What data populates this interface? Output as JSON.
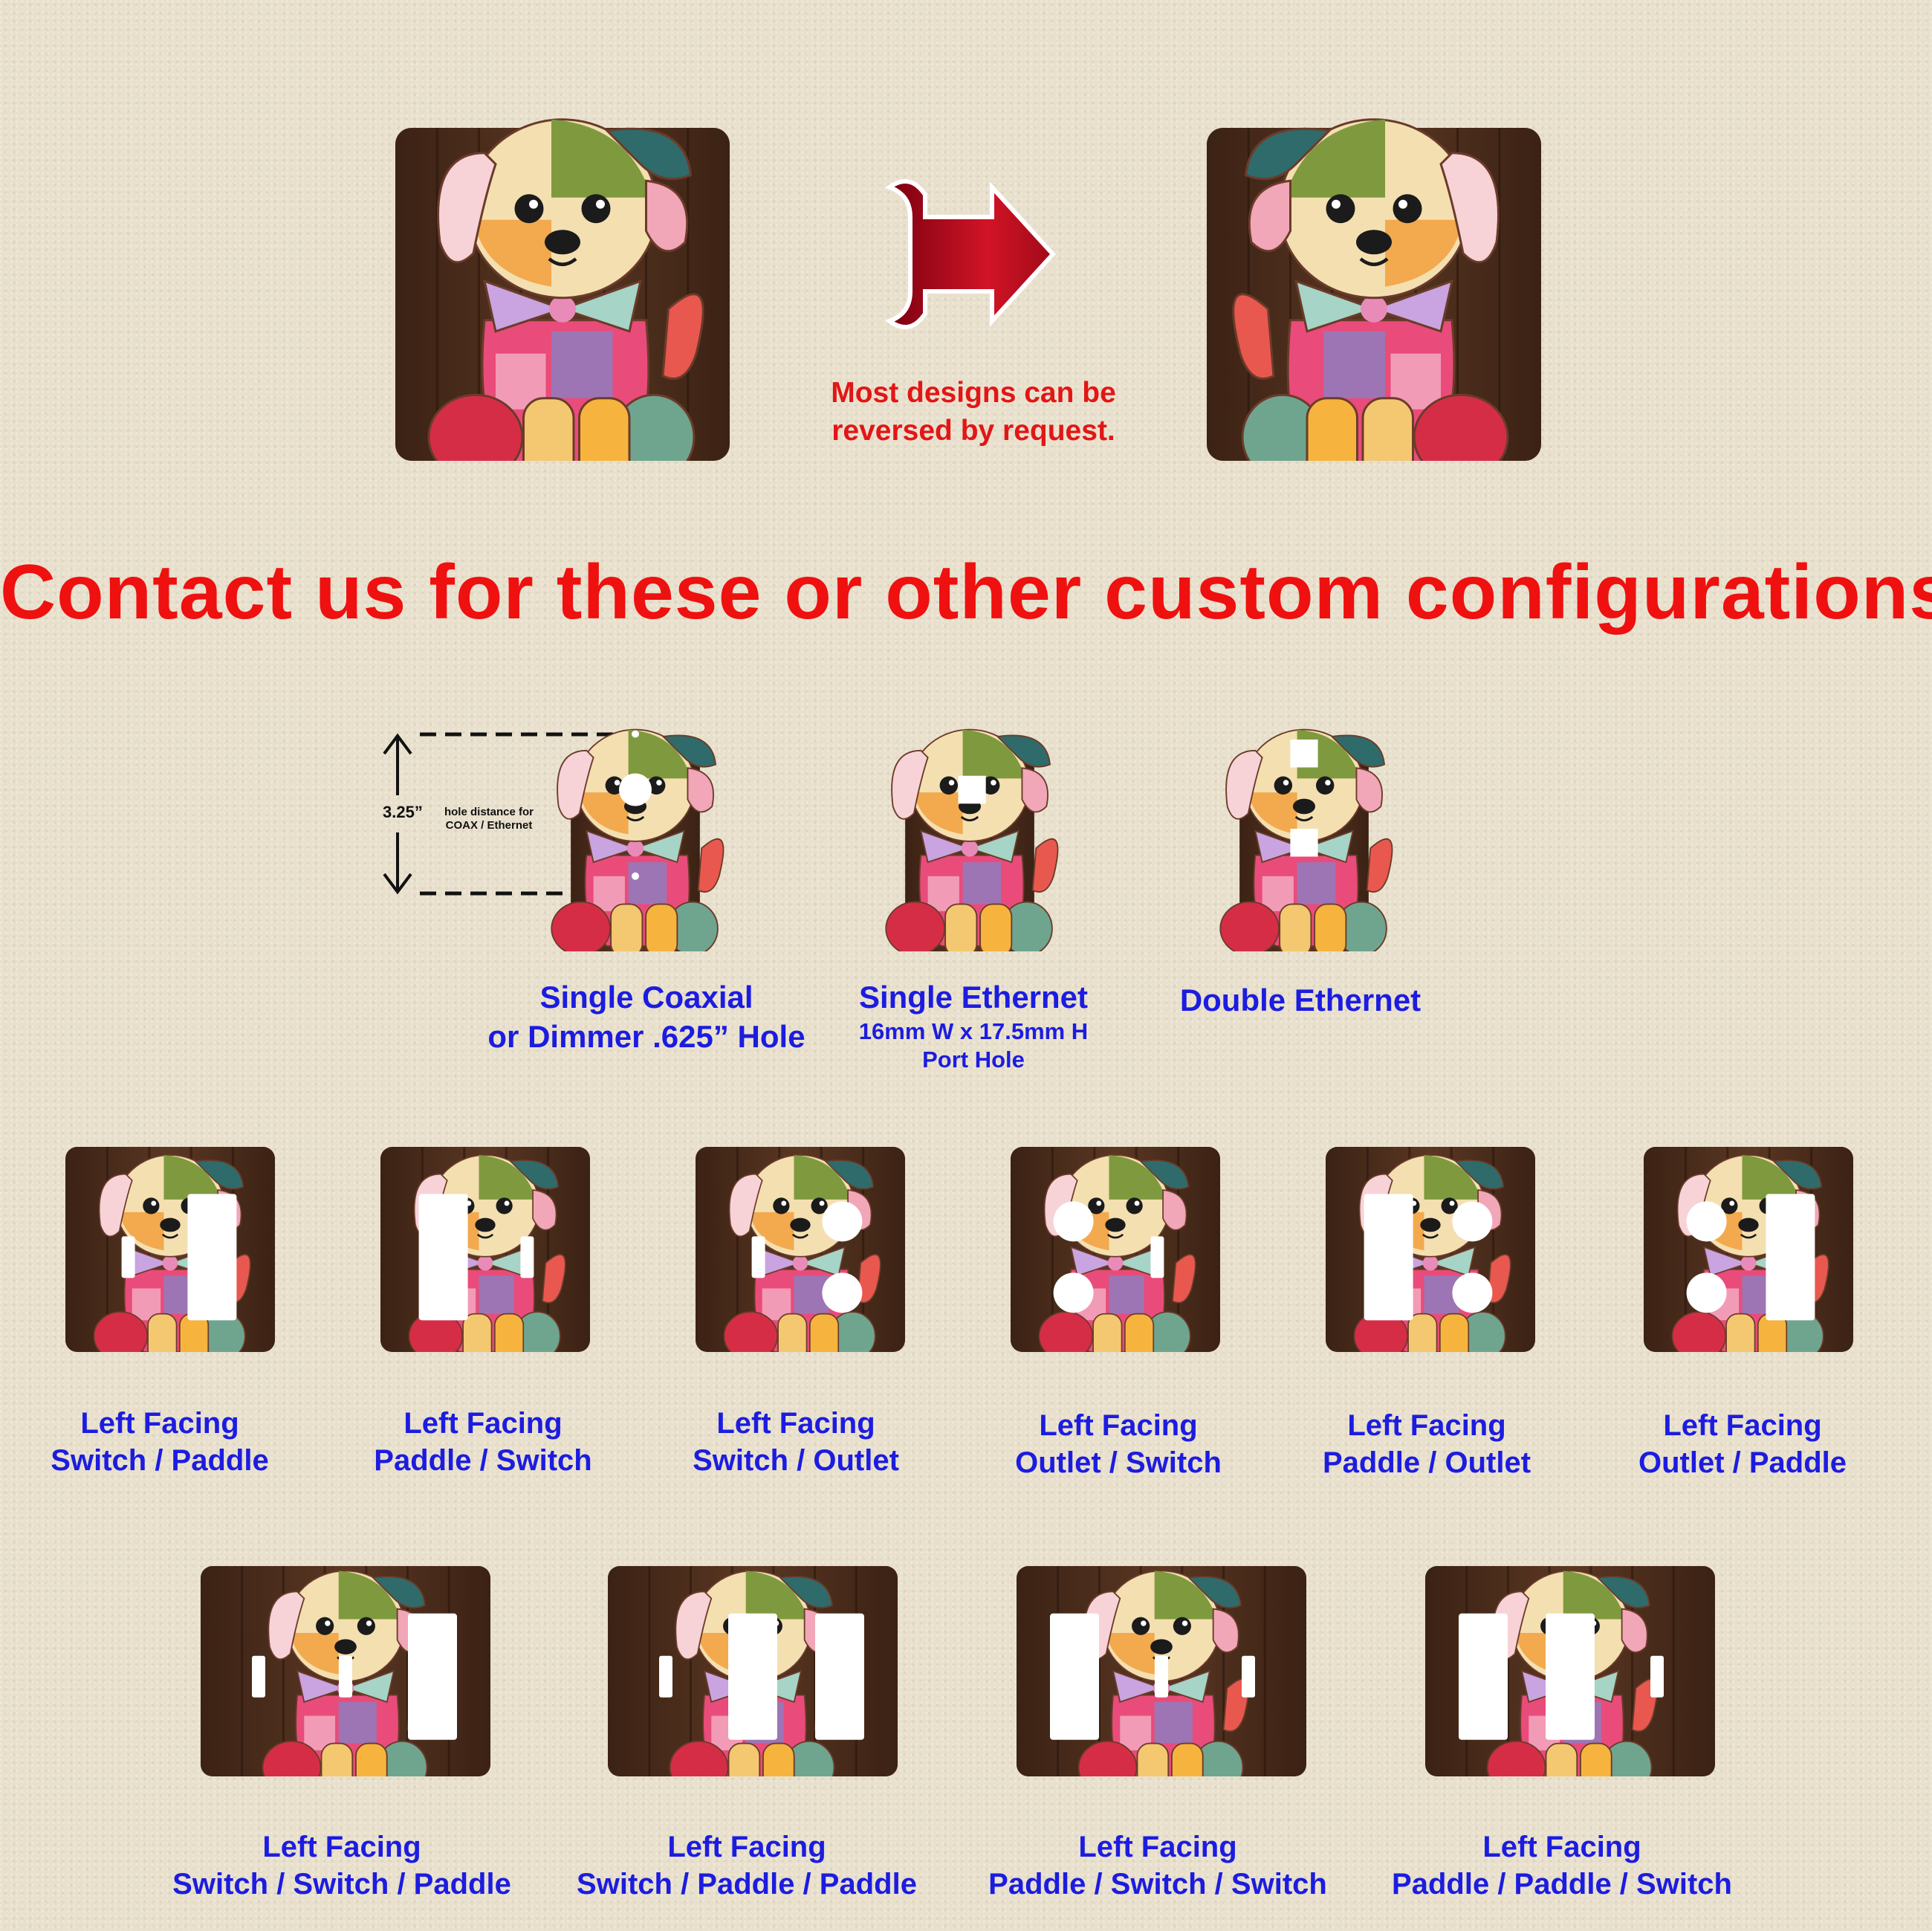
{
  "headline": "Contact us for these or other custom configurations.",
  "reverse_note": {
    "line1": "Most designs can be",
    "line2": "reversed by request."
  },
  "hole_note": {
    "distance": "3.25”",
    "line1": "hole distance for",
    "line2": "COAX / Ethernet"
  },
  "colors": {
    "headline": "#ef1010",
    "caption": "#1c1ce0",
    "wood": "#4a2c1c",
    "arrow": "#b8101e"
  },
  "plates_top": [
    {
      "caption": [
        "Single Coaxial",
        "or Dimmer .625” Hole"
      ]
    },
    {
      "caption": [
        "Single Ethernet"
      ],
      "sub": [
        "16mm W x 17.5mm H",
        "Port Hole"
      ]
    },
    {
      "caption": [
        "Double Ethernet"
      ]
    }
  ],
  "plates_double": [
    {
      "caption": [
        "Left Facing",
        "Switch / Paddle"
      ]
    },
    {
      "caption": [
        "Left Facing",
        "Paddle / Switch"
      ]
    },
    {
      "caption": [
        "Left Facing",
        "Switch / Outlet"
      ]
    },
    {
      "caption": [
        "Left Facing",
        "Outlet / Switch"
      ]
    },
    {
      "caption": [
        "Left Facing",
        "Paddle / Outlet"
      ]
    },
    {
      "caption": [
        "Left Facing",
        "Outlet / Paddle"
      ]
    }
  ],
  "plates_triple": [
    {
      "caption": [
        "Left Facing",
        "Switch / Switch / Paddle"
      ]
    },
    {
      "caption": [
        "Left Facing",
        "Switch / Paddle / Paddle"
      ]
    },
    {
      "caption": [
        "Left Facing",
        "Paddle / Switch / Switch"
      ]
    },
    {
      "caption": [
        "Left Facing",
        "Paddle / Paddle / Switch"
      ]
    }
  ]
}
